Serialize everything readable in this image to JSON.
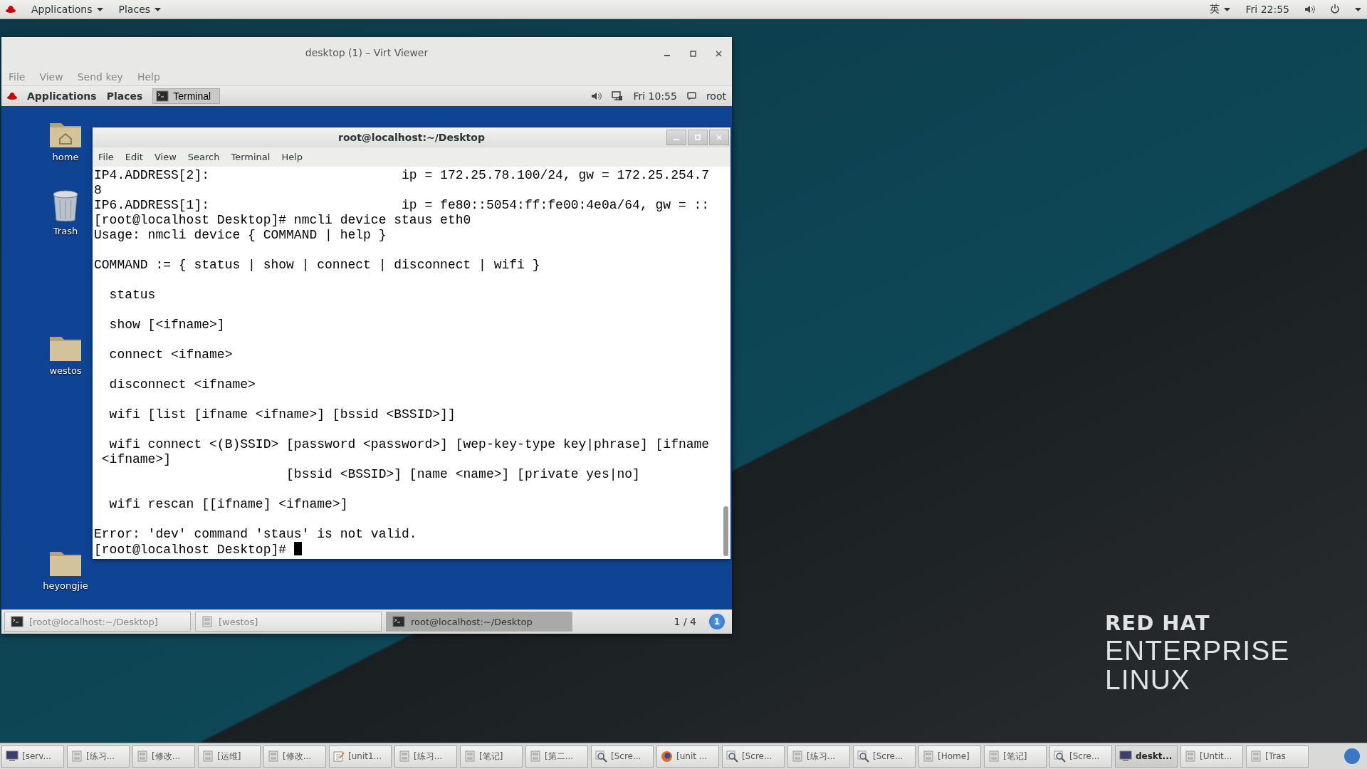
{
  "top_bar": {
    "menus": [
      "Applications",
      "Places"
    ],
    "input_method": "英",
    "clock": "Fri 22:55"
  },
  "viewer_window": {
    "title": "desktop (1) – Virt Viewer",
    "menu": [
      "File",
      "View",
      "Send key",
      "Help"
    ],
    "guest": {
      "panel": {
        "menus": [
          "Applications",
          "Places"
        ],
        "task": "Terminal",
        "clock": "Fri 10:55",
        "user": "root"
      },
      "desktop_icons": [
        {
          "label": "home",
          "kind": "home"
        },
        {
          "label": "Trash",
          "kind": "trash"
        },
        {
          "label": "westos",
          "kind": "folder"
        },
        {
          "label": "heyongjie",
          "kind": "folder"
        }
      ],
      "terminal": {
        "title": "root@localhost:~/Desktop",
        "menu": [
          "File",
          "Edit",
          "View",
          "Search",
          "Terminal",
          "Help"
        ],
        "blocks": [
          [
            "IP4.ADDRESS[2]:                         ip = 172.25.78.100/24, gw = 172.25.254.7",
            "8",
            "IP6.ADDRESS[1]:                         ip = fe80::5054:ff:fe00:4e0a/64, gw = ::",
            "[root@localhost Desktop]# nmcli device staus eth0",
            "Usage: nmcli device { COMMAND | help }"
          ],
          [
            "COMMAND := { status | show | connect | disconnect | wifi }"
          ],
          [
            "  status"
          ],
          [
            "  show [<ifname>]"
          ],
          [
            "  connect <ifname>"
          ],
          [
            "  disconnect <ifname>"
          ],
          [
            "  wifi [list [ifname <ifname>] [bssid <BSSID>]]"
          ],
          [
            "  wifi connect <(B)SSID> [password <password>] [wep-key-type key|phrase] [ifname",
            " <ifname>]",
            "                         [bssid <BSSID>] [name <name>] [private yes|no]"
          ],
          [
            "  wifi rescan [[ifname] <ifname>]"
          ],
          [
            "Error: 'dev' command 'staus' is not valid.",
            "[root@localhost Desktop]# "
          ]
        ]
      },
      "taskbar": [
        {
          "label": "[root@localhost:~/Desktop]",
          "kind": "terminal",
          "selected": false
        },
        {
          "label": "[westos]",
          "kind": "cabinet",
          "selected": false
        },
        {
          "label": "root@localhost:~/Desktop",
          "kind": "terminal",
          "selected": true
        }
      ],
      "workspace": "1 / 4",
      "notifications": "1"
    }
  },
  "wallpaper_logo": {
    "line_1": "RED HAT",
    "line_2": "ENTERPRISE",
    "line_3": "LINUX"
  },
  "taskbar": [
    {
      "label": "[serv...",
      "kind": "monitor",
      "selected": false
    },
    {
      "label": "[练习...",
      "kind": "cabinet",
      "selected": false
    },
    {
      "label": "[修改...",
      "kind": "cabinet",
      "selected": false
    },
    {
      "label": "[运维]",
      "kind": "cabinet",
      "selected": false
    },
    {
      "label": "[修改...",
      "kind": "cabinet",
      "selected": false
    },
    {
      "label": "[unit1...",
      "kind": "editor",
      "selected": false
    },
    {
      "label": "[练习...",
      "kind": "cabinet",
      "selected": false
    },
    {
      "label": "[笔记]",
      "kind": "cabinet",
      "selected": false
    },
    {
      "label": "[第二...",
      "kind": "cabinet",
      "selected": false
    },
    {
      "label": "[Scre...",
      "kind": "screenshot",
      "selected": false
    },
    {
      "label": "[unit ...",
      "kind": "browser",
      "selected": false
    },
    {
      "label": "[Scre...",
      "kind": "screenshot",
      "selected": false
    },
    {
      "label": "[练习...",
      "kind": "cabinet",
      "selected": false
    },
    {
      "label": "[Scre...",
      "kind": "screenshot",
      "selected": false
    },
    {
      "label": "[Home]",
      "kind": "cabinet",
      "selected": false
    },
    {
      "label": "[笔记]",
      "kind": "cabinet",
      "selected": false
    },
    {
      "label": "[Scre...",
      "kind": "screenshot",
      "selected": false
    },
    {
      "label": "deskt...",
      "kind": "monitor",
      "selected": true
    },
    {
      "label": "[Untit...",
      "kind": "cabinet",
      "selected": false
    },
    {
      "label": "[Tras",
      "kind": "cabinet",
      "selected": false
    }
  ]
}
